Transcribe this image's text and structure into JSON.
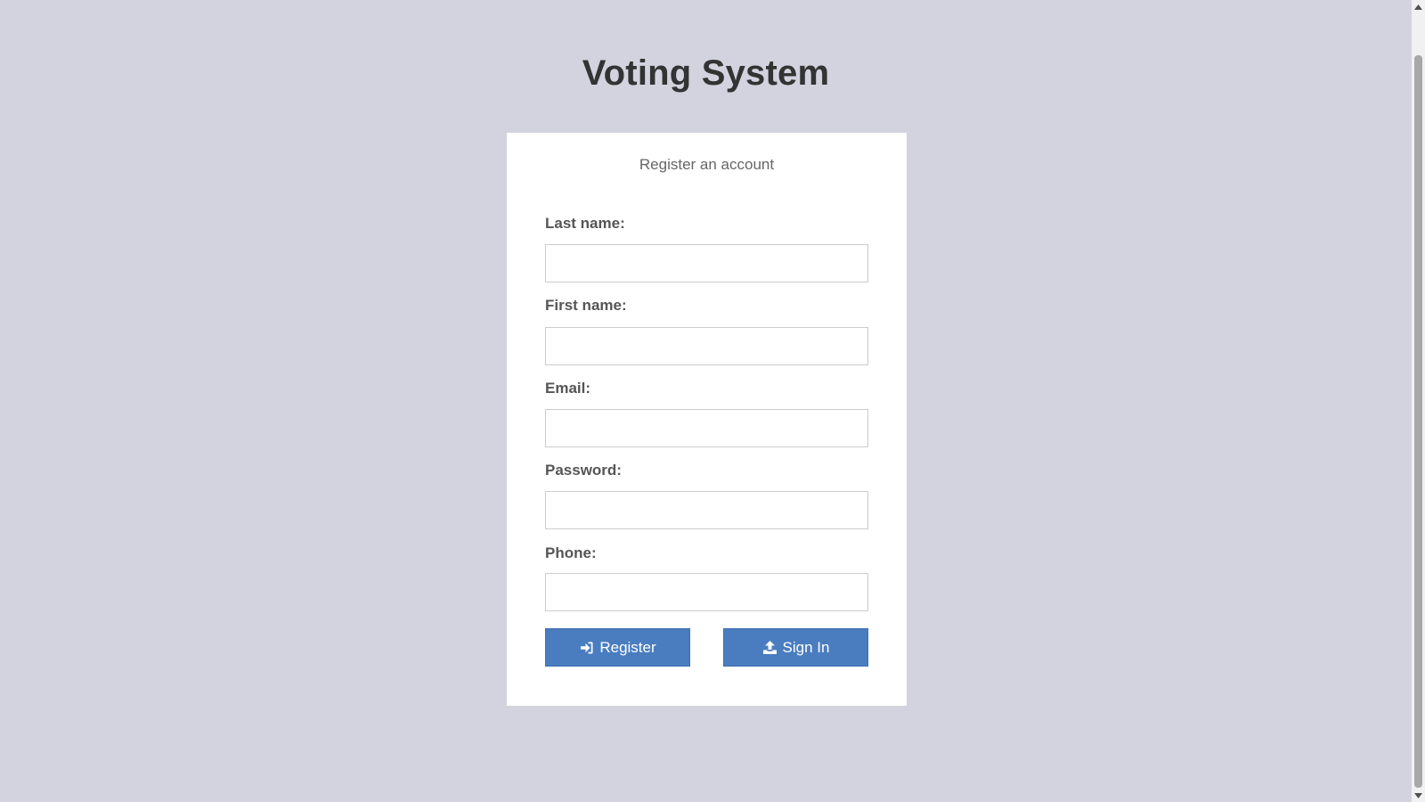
{
  "header": {
    "title": "Voting System"
  },
  "form": {
    "subtitle": "Register an account",
    "fields": [
      {
        "label": "Last name:",
        "value": "",
        "placeholder": ""
      },
      {
        "label": "First name:",
        "value": "",
        "placeholder": ""
      },
      {
        "label": "Email:",
        "value": "",
        "placeholder": ""
      },
      {
        "label": "Password:",
        "value": "",
        "placeholder": ""
      },
      {
        "label": "Phone:",
        "value": "",
        "placeholder": ""
      }
    ],
    "register_button": {
      "label": "Register",
      "icon": "sign-in-icon"
    },
    "signin_button": {
      "label": "Sign In",
      "icon": "upload-icon"
    }
  },
  "colors": {
    "background": "#d3d3df",
    "card": "#ffffff",
    "button": "#4a7dbf",
    "title_text": "#333333"
  }
}
